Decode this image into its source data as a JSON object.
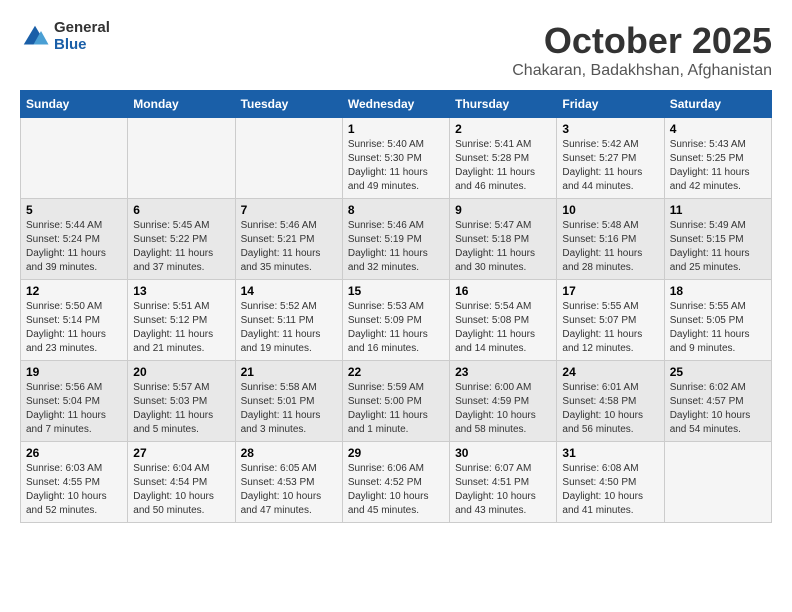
{
  "header": {
    "logo_general": "General",
    "logo_blue": "Blue",
    "month": "October 2025",
    "location": "Chakaran, Badakhshan, Afghanistan"
  },
  "weekdays": [
    "Sunday",
    "Monday",
    "Tuesday",
    "Wednesday",
    "Thursday",
    "Friday",
    "Saturday"
  ],
  "weeks": [
    [
      {
        "day": "",
        "info": ""
      },
      {
        "day": "",
        "info": ""
      },
      {
        "day": "",
        "info": ""
      },
      {
        "day": "1",
        "info": "Sunrise: 5:40 AM\nSunset: 5:30 PM\nDaylight: 11 hours\nand 49 minutes."
      },
      {
        "day": "2",
        "info": "Sunrise: 5:41 AM\nSunset: 5:28 PM\nDaylight: 11 hours\nand 46 minutes."
      },
      {
        "day": "3",
        "info": "Sunrise: 5:42 AM\nSunset: 5:27 PM\nDaylight: 11 hours\nand 44 minutes."
      },
      {
        "day": "4",
        "info": "Sunrise: 5:43 AM\nSunset: 5:25 PM\nDaylight: 11 hours\nand 42 minutes."
      }
    ],
    [
      {
        "day": "5",
        "info": "Sunrise: 5:44 AM\nSunset: 5:24 PM\nDaylight: 11 hours\nand 39 minutes."
      },
      {
        "day": "6",
        "info": "Sunrise: 5:45 AM\nSunset: 5:22 PM\nDaylight: 11 hours\nand 37 minutes."
      },
      {
        "day": "7",
        "info": "Sunrise: 5:46 AM\nSunset: 5:21 PM\nDaylight: 11 hours\nand 35 minutes."
      },
      {
        "day": "8",
        "info": "Sunrise: 5:46 AM\nSunset: 5:19 PM\nDaylight: 11 hours\nand 32 minutes."
      },
      {
        "day": "9",
        "info": "Sunrise: 5:47 AM\nSunset: 5:18 PM\nDaylight: 11 hours\nand 30 minutes."
      },
      {
        "day": "10",
        "info": "Sunrise: 5:48 AM\nSunset: 5:16 PM\nDaylight: 11 hours\nand 28 minutes."
      },
      {
        "day": "11",
        "info": "Sunrise: 5:49 AM\nSunset: 5:15 PM\nDaylight: 11 hours\nand 25 minutes."
      }
    ],
    [
      {
        "day": "12",
        "info": "Sunrise: 5:50 AM\nSunset: 5:14 PM\nDaylight: 11 hours\nand 23 minutes."
      },
      {
        "day": "13",
        "info": "Sunrise: 5:51 AM\nSunset: 5:12 PM\nDaylight: 11 hours\nand 21 minutes."
      },
      {
        "day": "14",
        "info": "Sunrise: 5:52 AM\nSunset: 5:11 PM\nDaylight: 11 hours\nand 19 minutes."
      },
      {
        "day": "15",
        "info": "Sunrise: 5:53 AM\nSunset: 5:09 PM\nDaylight: 11 hours\nand 16 minutes."
      },
      {
        "day": "16",
        "info": "Sunrise: 5:54 AM\nSunset: 5:08 PM\nDaylight: 11 hours\nand 14 minutes."
      },
      {
        "day": "17",
        "info": "Sunrise: 5:55 AM\nSunset: 5:07 PM\nDaylight: 11 hours\nand 12 minutes."
      },
      {
        "day": "18",
        "info": "Sunrise: 5:55 AM\nSunset: 5:05 PM\nDaylight: 11 hours\nand 9 minutes."
      }
    ],
    [
      {
        "day": "19",
        "info": "Sunrise: 5:56 AM\nSunset: 5:04 PM\nDaylight: 11 hours\nand 7 minutes."
      },
      {
        "day": "20",
        "info": "Sunrise: 5:57 AM\nSunset: 5:03 PM\nDaylight: 11 hours\nand 5 minutes."
      },
      {
        "day": "21",
        "info": "Sunrise: 5:58 AM\nSunset: 5:01 PM\nDaylight: 11 hours\nand 3 minutes."
      },
      {
        "day": "22",
        "info": "Sunrise: 5:59 AM\nSunset: 5:00 PM\nDaylight: 11 hours\nand 1 minute."
      },
      {
        "day": "23",
        "info": "Sunrise: 6:00 AM\nSunset: 4:59 PM\nDaylight: 10 hours\nand 58 minutes."
      },
      {
        "day": "24",
        "info": "Sunrise: 6:01 AM\nSunset: 4:58 PM\nDaylight: 10 hours\nand 56 minutes."
      },
      {
        "day": "25",
        "info": "Sunrise: 6:02 AM\nSunset: 4:57 PM\nDaylight: 10 hours\nand 54 minutes."
      }
    ],
    [
      {
        "day": "26",
        "info": "Sunrise: 6:03 AM\nSunset: 4:55 PM\nDaylight: 10 hours\nand 52 minutes."
      },
      {
        "day": "27",
        "info": "Sunrise: 6:04 AM\nSunset: 4:54 PM\nDaylight: 10 hours\nand 50 minutes."
      },
      {
        "day": "28",
        "info": "Sunrise: 6:05 AM\nSunset: 4:53 PM\nDaylight: 10 hours\nand 47 minutes."
      },
      {
        "day": "29",
        "info": "Sunrise: 6:06 AM\nSunset: 4:52 PM\nDaylight: 10 hours\nand 45 minutes."
      },
      {
        "day": "30",
        "info": "Sunrise: 6:07 AM\nSunset: 4:51 PM\nDaylight: 10 hours\nand 43 minutes."
      },
      {
        "day": "31",
        "info": "Sunrise: 6:08 AM\nSunset: 4:50 PM\nDaylight: 10 hours\nand 41 minutes."
      },
      {
        "day": "",
        "info": ""
      }
    ]
  ]
}
